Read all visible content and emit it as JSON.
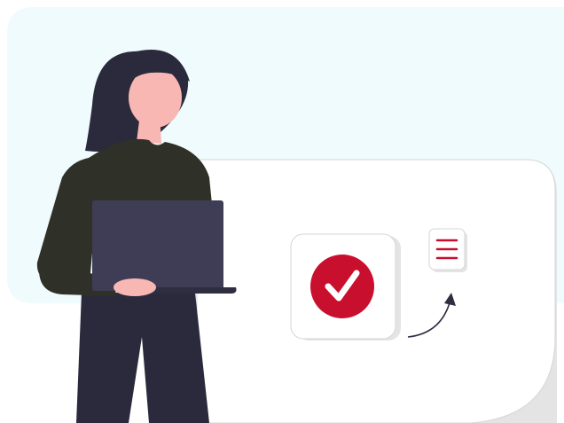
{
  "illustration": {
    "colors": {
      "background_panel": "#effbfc",
      "card_outline": "#d6d6d6",
      "card_shadow": "#e4e4e4",
      "check_badge": "#c8102e",
      "check_mark": "#ffffff",
      "menu_lines": "#c8102e",
      "shirt": "#2f3129",
      "pants": "#2b2a3d",
      "hair": "#2b2a3d",
      "skin": "#f8b7b3",
      "laptop": "#3f3d56",
      "laptop_base": "#2f2e41",
      "arrow": "#2f2e41"
    },
    "icons": [
      "check-circle-icon",
      "menu-list-icon",
      "curved-arrow-icon"
    ]
  }
}
